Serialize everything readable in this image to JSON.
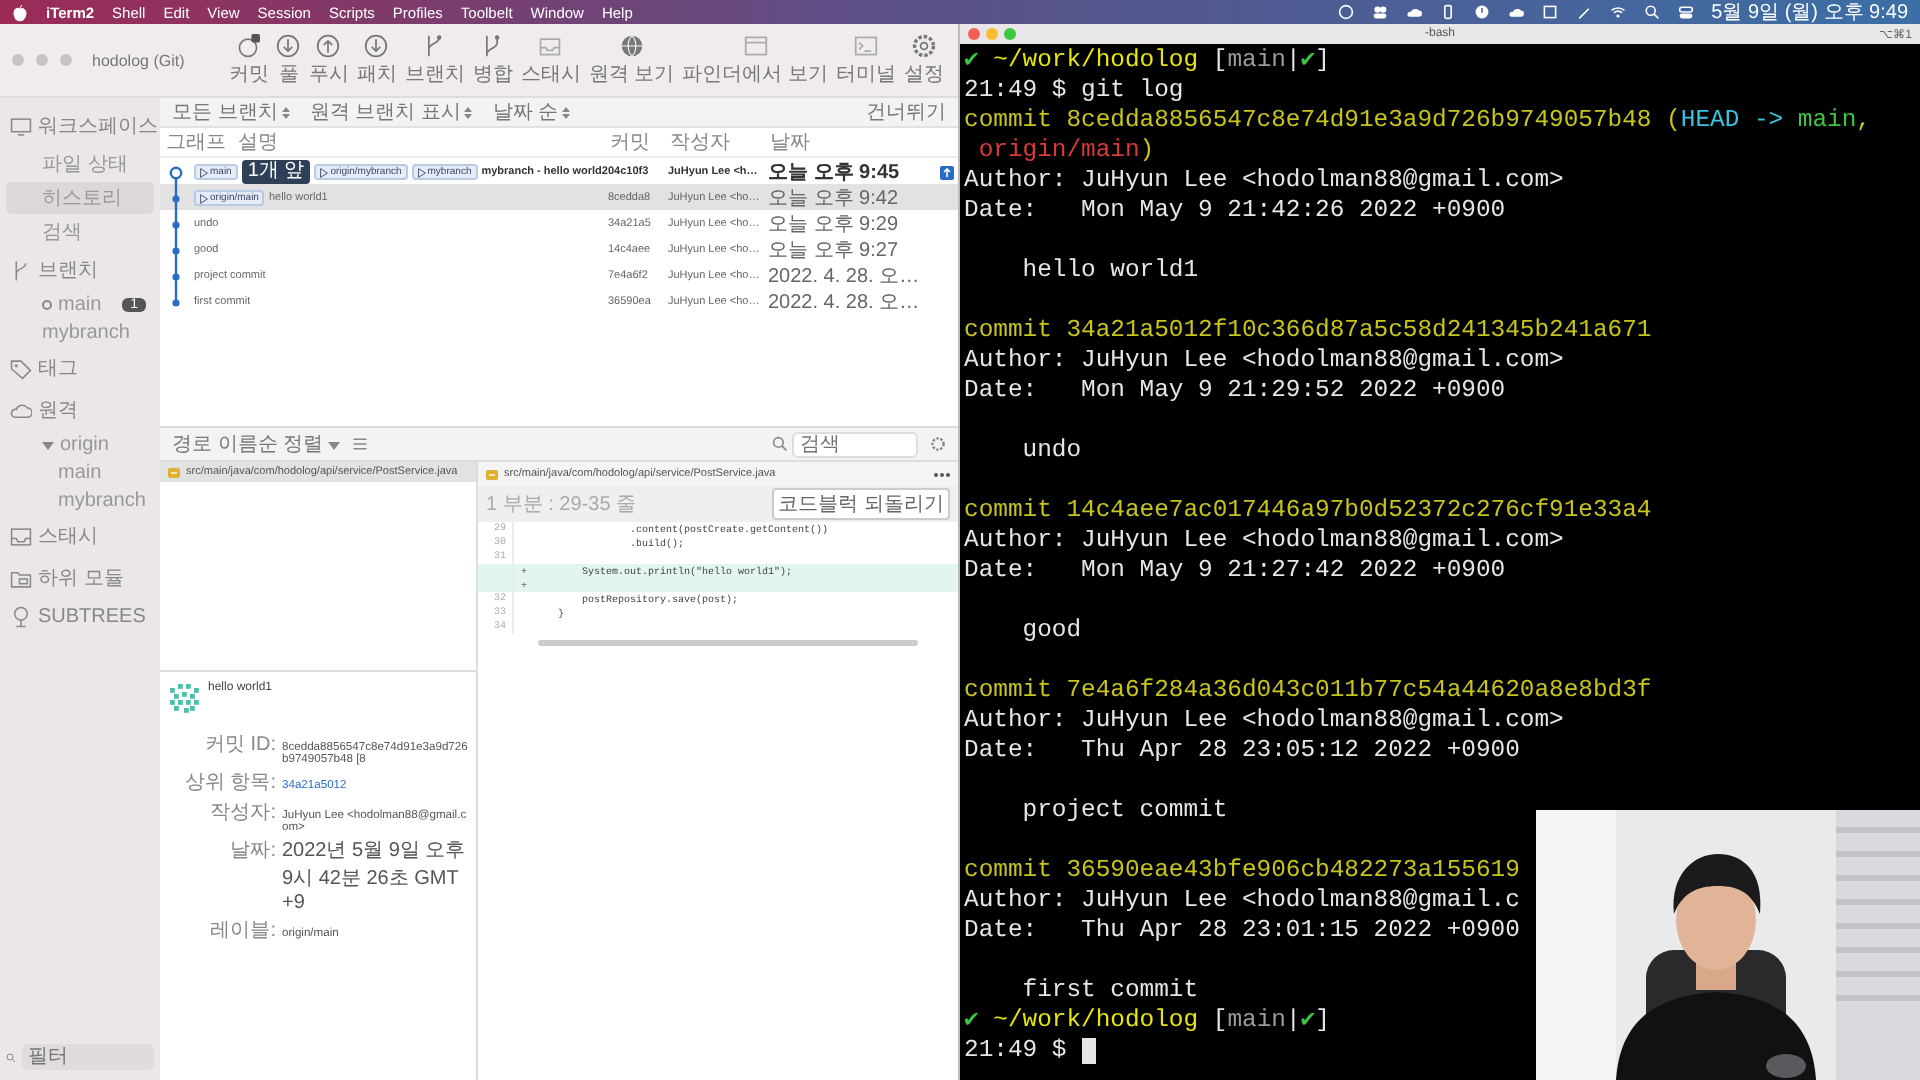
{
  "menu_bar": {
    "app": "iTerm2",
    "items": [
      "Shell",
      "Edit",
      "View",
      "Session",
      "Scripts",
      "Profiles",
      "Toolbelt",
      "Window",
      "Help"
    ],
    "clock": "5월 9일 (월) 오후 9:49"
  },
  "sourcetree": {
    "title": "hodolog (Git)",
    "toolbar": [
      {
        "label": "커밋",
        "kind": "commit"
      },
      {
        "label": "풀",
        "kind": "pull"
      },
      {
        "label": "푸시",
        "kind": "push"
      },
      {
        "label": "패치",
        "kind": "fetch"
      },
      {
        "label": "브랜치",
        "kind": "branch"
      },
      {
        "label": "병합",
        "kind": "merge"
      },
      {
        "label": "스태시",
        "kind": "stash"
      },
      {
        "label": "원격 보기",
        "kind": "remote"
      },
      {
        "label": "파인더에서 보기",
        "kind": "finder"
      },
      {
        "label": "터미널",
        "kind": "terminal"
      },
      {
        "label": "설정",
        "kind": "settings"
      }
    ],
    "sidebar": [
      {
        "label": "워크스페이스",
        "kind": "workspace",
        "children": [
          {
            "label": "파일 상태",
            "selected": false
          },
          {
            "label": "히스토리",
            "selected": true
          },
          {
            "label": "검색",
            "selected": false
          }
        ]
      },
      {
        "label": "브랜치",
        "kind": "branch",
        "children": [
          {
            "label": "main",
            "selected": false,
            "current": true,
            "badge": "1"
          },
          {
            "label": "mybranch",
            "selected": false,
            "current": false
          }
        ]
      },
      {
        "label": "태그",
        "kind": "tag"
      },
      {
        "label": "원격",
        "kind": "remote",
        "children": [
          {
            "label": "origin",
            "expanded": true,
            "children": [
              {
                "label": "main",
                "selected": false
              },
              {
                "label": "mybranch",
                "selected": false
              }
            ]
          }
        ]
      },
      {
        "label": "스태시",
        "kind": "stash"
      },
      {
        "label": "하위 모듈",
        "kind": "submodule"
      },
      {
        "label": "SUBTREES",
        "kind": "subtree"
      }
    ],
    "sidebar_filter": {
      "placeholder": "필터"
    },
    "filters": [
      "모든 브랜치",
      "원격 브랜치 표시",
      "날짜 순"
    ],
    "filter_right": "건너뛰기",
    "columns": [
      "그래프",
      "설명",
      "커밋",
      "작성자",
      "날짜"
    ],
    "commits": [
      {
        "tags": [
          {
            "text": "main",
            "kind": "local"
          },
          {
            "text": "1개 앞",
            "kind": "ahead"
          },
          {
            "text": "origin/mybranch",
            "kind": "remote"
          },
          {
            "text": "mybranch",
            "kind": "local"
          }
        ],
        "message": "mybranch - hello world2",
        "hash": "04c10f3",
        "author": "JuHyun Lee <h…",
        "date": "오늘 오후 9:45",
        "head": true,
        "selected": false
      },
      {
        "tags": [
          {
            "text": "origin/main",
            "kind": "remote"
          }
        ],
        "message": "hello world1",
        "hash": "8cedda8",
        "author": "JuHyun Lee <ho…",
        "date": "오늘 오후 9:42",
        "head": false,
        "selected": true
      },
      {
        "message": "undo",
        "hash": "34a21a5",
        "author": "JuHyun Lee <ho…",
        "date": "오늘 오후 9:29",
        "head": false,
        "selected": false
      },
      {
        "message": "good",
        "hash": "14c4aee",
        "author": "JuHyun Lee <ho…",
        "date": "오늘 오후 9:27",
        "head": false,
        "selected": false
      },
      {
        "message": "project commit",
        "hash": "7e4a6f2",
        "author": "JuHyun Lee <ho…",
        "date": "2022. 4. 28. 오…",
        "head": false,
        "selected": false
      },
      {
        "message": "first commit",
        "hash": "36590ea",
        "author": "JuHyun Lee <ho…",
        "date": "2022. 4. 28. 오…",
        "head": false,
        "selected": false
      }
    ],
    "files_toolbar": {
      "sort": "경로 이름순 정렬",
      "search_placeholder": "검색"
    },
    "files": [
      {
        "path": "src/main/java/com/hodolog/api/service/PostService.java",
        "selected": true
      }
    ],
    "diff": {
      "path": "src/main/java/com/hodolog/api/service/PostService.java",
      "hunk": "1 부분 : 29-35 줄",
      "revert": "코드블럭 되돌리기",
      "lines": [
        {
          "kind": "context",
          "num": "29",
          "text": "                .content(postCreate.getContent())"
        },
        {
          "kind": "context",
          "num": "30",
          "text": "                .build();"
        },
        {
          "kind": "context",
          "num": "31"
        },
        {
          "kind": "added",
          "sign": "+",
          "text": "        System.out.println(\"hello world1\");"
        },
        {
          "kind": "added",
          "sign": "+"
        },
        {
          "kind": "context",
          "num": "32",
          "text": "        postRepository.save(post);"
        },
        {
          "kind": "context",
          "num": "33",
          "text": "    }"
        },
        {
          "kind": "context",
          "num": "34"
        }
      ]
    },
    "details": {
      "message": "hello world1",
      "fields": [
        {
          "label": "커밋 ID:",
          "value": "8cedda8856547c8e74d91e3a9d726b9749057b48 [8",
          "kind": "text"
        },
        {
          "label": "상위 항목:",
          "value": "34a21a5012",
          "kind": "link"
        },
        {
          "label": "작성자:",
          "value": "JuHyun Lee <hodolman88@gmail.com>",
          "kind": "text"
        },
        {
          "label": "날짜:",
          "value": "2022년 5월 9일 오후 9시 42분 26초 GMT+9",
          "kind": "text"
        },
        {
          "label": "레이블:",
          "value": "origin/main",
          "kind": "text"
        }
      ]
    }
  },
  "terminal": {
    "title": "-bash",
    "shortcut": "⌥⌘1",
    "lines": [
      {
        "kind": "text",
        "segments": [
          {
            "text": "✔ ",
            "color": "#3fc43f"
          },
          {
            "text": "~/work/hodolog ",
            "color": "#e5e510"
          },
          {
            "text": "[",
            "color": "#e6e6e6"
          },
          {
            "text": "main",
            "color": "#9a9a9a"
          },
          {
            "text": "|",
            "color": "#e6e6e6"
          },
          {
            "text": "✔",
            "color": "#3fc43f"
          },
          {
            "text": "]",
            "color": "#e6e6e6"
          }
        ]
      },
      {
        "kind": "text",
        "segments": [
          {
            "text": "21:49 $ git log",
            "color": "#e6e6e6"
          }
        ]
      },
      {
        "kind": "text",
        "segments": [
          {
            "text": "commit 8cedda8856547c8e74d91e3a9d726b9749057b48 (",
            "color": "#c7c41c"
          },
          {
            "text": "HEAD -> ",
            "color": "#3cc2e0"
          },
          {
            "text": "main",
            "color": "#3fc43f"
          },
          {
            "text": ",",
            "color": "#c7c41c"
          }
        ]
      },
      {
        "kind": "text",
        "segments": [
          {
            "text": " origin/main",
            "color": "#d83a3a"
          },
          {
            "text": ")",
            "color": "#c7c41c"
          }
        ]
      },
      {
        "kind": "text",
        "segments": [
          {
            "text": "Author: JuHyun Lee <hodolman88@gmail.com>",
            "color": "#e6e6e6"
          }
        ]
      },
      {
        "kind": "text",
        "segments": [
          {
            "text": "Date:   Mon May 9 21:42:26 2022 +0900",
            "color": "#e6e6e6"
          }
        ]
      },
      {
        "kind": "blank"
      },
      {
        "kind": "text",
        "segments": [
          {
            "text": "    hello world1",
            "color": "#e6e6e6"
          }
        ]
      },
      {
        "kind": "blank"
      },
      {
        "kind": "text",
        "segments": [
          {
            "text": "commit 34a21a5012f10c366d87a5c58d241345b241a671",
            "color": "#c7c41c"
          }
        ]
      },
      {
        "kind": "text",
        "segments": [
          {
            "text": "Author: JuHyun Lee <hodolman88@gmail.com>",
            "color": "#e6e6e6"
          }
        ]
      },
      {
        "kind": "text",
        "segments": [
          {
            "text": "Date:   Mon May 9 21:29:52 2022 +0900",
            "color": "#e6e6e6"
          }
        ]
      },
      {
        "kind": "blank"
      },
      {
        "kind": "text",
        "segments": [
          {
            "text": "    undo",
            "color": "#e6e6e6"
          }
        ]
      },
      {
        "kind": "blank"
      },
      {
        "kind": "text",
        "segments": [
          {
            "text": "commit 14c4aee7ac017446a97b0d52372c276cf91e33a4",
            "color": "#c7c41c"
          }
        ]
      },
      {
        "kind": "text",
        "segments": [
          {
            "text": "Author: JuHyun Lee <hodolman88@gmail.com>",
            "color": "#e6e6e6"
          }
        ]
      },
      {
        "kind": "text",
        "segments": [
          {
            "text": "Date:   Mon May 9 21:27:42 2022 +0900",
            "color": "#e6e6e6"
          }
        ]
      },
      {
        "kind": "blank"
      },
      {
        "kind": "text",
        "segments": [
          {
            "text": "    good",
            "color": "#e6e6e6"
          }
        ]
      },
      {
        "kind": "blank"
      },
      {
        "kind": "text",
        "segments": [
          {
            "text": "commit 7e4a6f284a36d043c011b77c54a44620a8e8bd3f",
            "color": "#c7c41c"
          }
        ]
      },
      {
        "kind": "text",
        "segments": [
          {
            "text": "Author: JuHyun Lee <hodolman88@gmail.com>",
            "color": "#e6e6e6"
          }
        ]
      },
      {
        "kind": "text",
        "segments": [
          {
            "text": "Date:   Thu Apr 28 23:05:12 2022 +0900",
            "color": "#e6e6e6"
          }
        ]
      },
      {
        "kind": "blank"
      },
      {
        "kind": "text",
        "segments": [
          {
            "text": "    project commit",
            "color": "#e6e6e6"
          }
        ]
      },
      {
        "kind": "blank"
      },
      {
        "kind": "text",
        "segments": [
          {
            "text": "commit 36590eae43bfe906cb482273a155619",
            "color": "#c7c41c"
          }
        ]
      },
      {
        "kind": "text",
        "segments": [
          {
            "text": "Author: JuHyun Lee <hodolman88@gmail.c",
            "color": "#e6e6e6"
          }
        ]
      },
      {
        "kind": "text",
        "segments": [
          {
            "text": "Date:   Thu Apr 28 23:01:15 2022 +0900",
            "color": "#e6e6e6"
          }
        ]
      },
      {
        "kind": "blank"
      },
      {
        "kind": "text",
        "segments": [
          {
            "text": "    first commit",
            "color": "#e6e6e6"
          }
        ]
      },
      {
        "kind": "text",
        "segments": [
          {
            "text": "✔ ",
            "color": "#3fc43f"
          },
          {
            "text": "~/work/hodolog ",
            "color": "#e5e510"
          },
          {
            "text": "[",
            "color": "#e6e6e6"
          },
          {
            "text": "main",
            "color": "#9a9a9a"
          },
          {
            "text": "|",
            "color": "#e6e6e6"
          },
          {
            "text": "✔",
            "color": "#3fc43f"
          },
          {
            "text": "]",
            "color": "#e6e6e6"
          }
        ]
      },
      {
        "kind": "text",
        "cursor": true,
        "segments": [
          {
            "text": "21:49 $ ",
            "color": "#e6e6e6"
          }
        ]
      }
    ]
  }
}
